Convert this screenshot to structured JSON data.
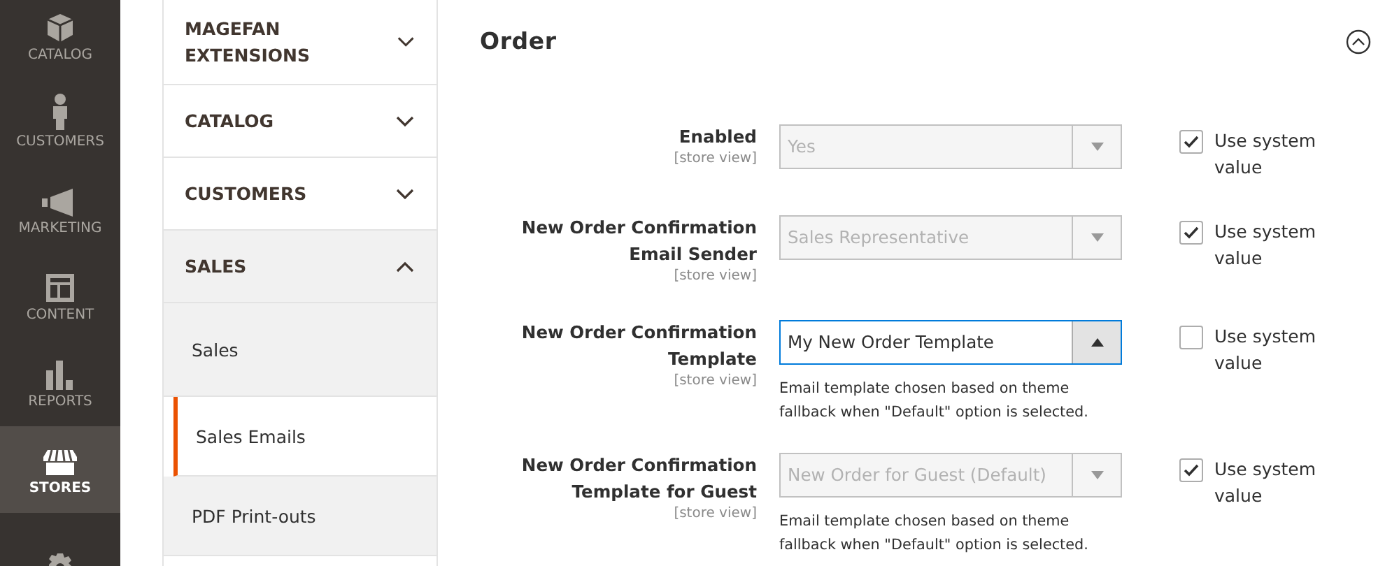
{
  "nav": [
    {
      "label": "CATALOG",
      "selected": false
    },
    {
      "label": "CUSTOMERS",
      "selected": false
    },
    {
      "label": "MARKETING",
      "selected": false
    },
    {
      "label": "CONTENT",
      "selected": false
    },
    {
      "label": "REPORTS",
      "selected": false
    },
    {
      "label": "STORES",
      "selected": true
    },
    {
      "selected": false
    }
  ],
  "config_tabs": [
    {
      "label": "MAGEFAN EXTENSIONS",
      "expanded": false
    },
    {
      "label": "CATALOG",
      "expanded": false
    },
    {
      "label": "CUSTOMERS",
      "expanded": false
    },
    {
      "label": "SALES",
      "expanded": true,
      "children": [
        {
          "label": "Sales",
          "selected": false
        },
        {
          "label": "Sales Emails",
          "selected": true
        },
        {
          "label": "PDF Print-outs",
          "selected": false
        }
      ]
    }
  ],
  "section": {
    "title": "Order",
    "expanded": true
  },
  "fields": [
    {
      "label": "Enabled",
      "scope": "[store view]",
      "value": "Yes",
      "disabled": true,
      "open": false,
      "use_system_value": {
        "label": "Use system value",
        "checked": true
      }
    },
    {
      "label": "New Order Confirmation Email Sender",
      "scope": "[store view]",
      "value": "Sales Representative",
      "disabled": true,
      "open": false,
      "use_system_value": {
        "label": "Use system value",
        "checked": true
      }
    },
    {
      "label": "New Order Confirmation Template",
      "scope": "[store view]",
      "value": "My New Order Template",
      "disabled": false,
      "open": true,
      "note": "Email template chosen based on theme fallback when \"Default\" option is selected.",
      "use_system_value": {
        "label": "Use system value",
        "checked": false
      }
    },
    {
      "label": "New Order Confirmation Template for Guest",
      "scope": "[store view]",
      "value": "New Order for Guest (Default)",
      "disabled": true,
      "open": false,
      "note": "Email template chosen based on theme fallback when \"Default\" option is selected.",
      "use_system_value": {
        "label": "Use system value",
        "checked": true
      }
    }
  ]
}
